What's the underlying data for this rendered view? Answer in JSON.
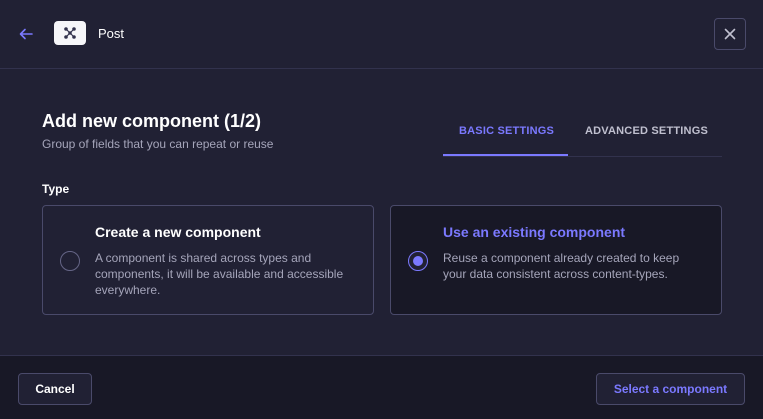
{
  "header": {
    "back_icon": "arrow-left-icon",
    "type_icon": "component-icon",
    "title": "Post",
    "close_icon": "close-icon"
  },
  "main": {
    "title": "Add new component (1/2)",
    "subtitle": "Group of fields that you can repeat or reuse",
    "tabs": [
      {
        "label": "BASIC SETTINGS",
        "active": true
      },
      {
        "label": "ADVANCED SETTINGS",
        "active": false
      }
    ],
    "type_label": "Type",
    "options": [
      {
        "title": "Create a new component",
        "description": "A component is shared across types and components, it will be available and accessible everywhere.",
        "selected": false
      },
      {
        "title": "Use an existing component",
        "description": "Reuse a component already created to keep your data consistent across content-types.",
        "selected": true
      }
    ]
  },
  "footer": {
    "cancel_label": "Cancel",
    "submit_label": "Select a component"
  },
  "colors": {
    "accent": "#7b79ff",
    "background": "#181826",
    "surface": "#212134",
    "border": "#4a4a6a"
  }
}
